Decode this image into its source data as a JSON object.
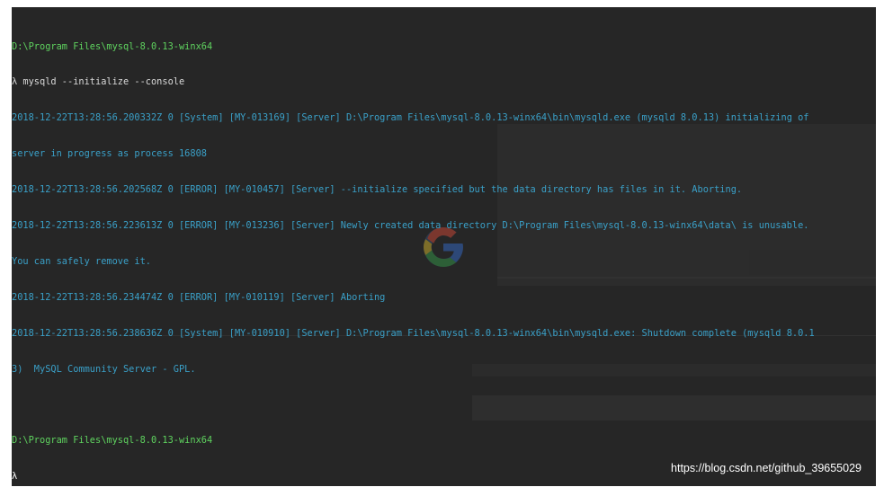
{
  "terminal": {
    "prompt1": "D:\\Program Files\\mysql-8.0.13-winx64",
    "command": "λ mysqld --initialize --console",
    "log_lines": [
      "2018-12-22T13:28:56.200332Z 0 [System] [MY-013169] [Server] D:\\Program Files\\mysql-8.0.13-winx64\\bin\\mysqld.exe (mysqld 8.0.13) initializing of",
      "server in progress as process 16808",
      "2018-12-22T13:28:56.202568Z 0 [ERROR] [MY-010457] [Server] --initialize specified but the data directory has files in it. Aborting.",
      "2018-12-22T13:28:56.223613Z 0 [ERROR] [MY-013236] [Server] Newly created data directory D:\\Program Files\\mysql-8.0.13-winx64\\data\\ is unusable.",
      "You can safely remove it.",
      "2018-12-22T13:28:56.234474Z 0 [ERROR] [MY-010119] [Server] Aborting",
      "2018-12-22T13:28:56.238636Z 0 [System] [MY-010910] [Server] D:\\Program Files\\mysql-8.0.13-winx64\\bin\\mysqld.exe: Shutdown complete (mysqld 8.0.1",
      "3)  MySQL Community Server - GPL."
    ],
    "prompt2": "D:\\Program Files\\mysql-8.0.13-winx64",
    "cursor_line": "λ"
  },
  "watermark": "https://blog.csdn.net/github_39655029",
  "colors": {
    "background": "#262626",
    "prompt": "#5fd35f",
    "log": "#3aa0c8",
    "command": "#d8d8d8"
  },
  "icons": {
    "background_logo": "google-g-icon"
  }
}
